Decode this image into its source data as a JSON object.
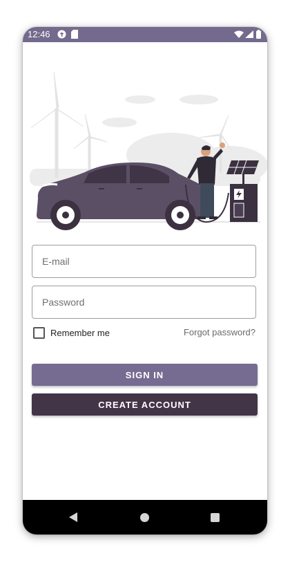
{
  "status_bar": {
    "time": "12:46",
    "background": "#736a8d",
    "left_icons": [
      "circle-status-icon",
      "sd-card-icon"
    ],
    "right_icons": [
      "wifi-icon",
      "signal-icon",
      "battery-icon"
    ]
  },
  "illustration": {
    "subject": "person charging electric car at charging station with wind turbines and solar panel",
    "icons": [
      "electric-car-icon",
      "wind-turbine-icon",
      "charging-station-icon",
      "solar-panel-icon"
    ]
  },
  "form": {
    "email_placeholder": "E-mail",
    "password_placeholder": "Password",
    "remember_me_label": "Remember me",
    "remember_me_checked": false,
    "forgot_password_label": "Forgot password?"
  },
  "buttons": {
    "sign_in_label": "SIGN IN",
    "create_account_label": "CREATE ACCOUNT",
    "sign_in_color": "#766c92",
    "create_account_color": "#433548"
  },
  "nav_bar": {
    "icons": [
      "back-icon",
      "home-icon",
      "recents-icon"
    ]
  }
}
